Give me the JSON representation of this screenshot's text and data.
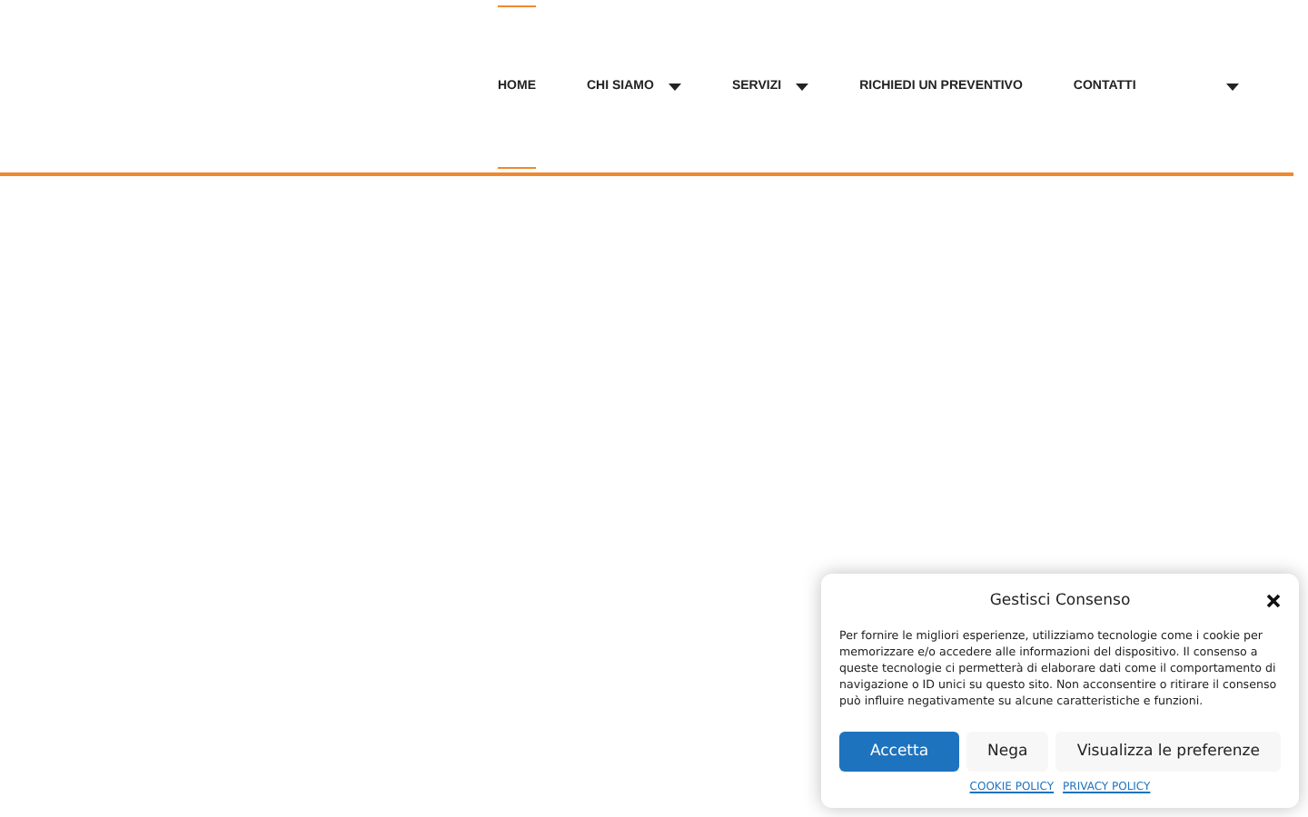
{
  "nav": {
    "items": [
      {
        "label": "HOME",
        "selected": true,
        "has_dropdown": false
      },
      {
        "label": "CHI SIAMO",
        "selected": false,
        "has_dropdown": true
      },
      {
        "label": "SERVIZI",
        "selected": false,
        "has_dropdown": true
      },
      {
        "label": "RICHIEDI UN PREVENTIVO",
        "selected": false,
        "has_dropdown": false
      },
      {
        "label": "CONTATTI",
        "selected": false,
        "has_dropdown": false
      },
      {
        "selected": false,
        "has_dropdown": true
      }
    ]
  },
  "consent": {
    "title": "Gestisci Consenso",
    "message": "Per fornire le migliori esperienze, utilizziamo tecnologie come i cookie per memorizzare e/o accedere alle informazioni del dispositivo. Il consenso a queste tecnologie ci permetterà di elaborare dati come il comportamento di navigazione o ID unici su questo sito. Non acconsentire o ritirare il consenso può influire negativamente su alcune caratteristiche e funzioni.",
    "buttons": [
      {
        "label": "Accetta",
        "kind": "primary"
      },
      {
        "label": "Nega",
        "kind": "secondary"
      },
      {
        "label": "Visualizza le preferenze",
        "kind": "secondary"
      }
    ],
    "links": [
      "COOKIE POLICY",
      "PRIVACY POLICY"
    ]
  }
}
